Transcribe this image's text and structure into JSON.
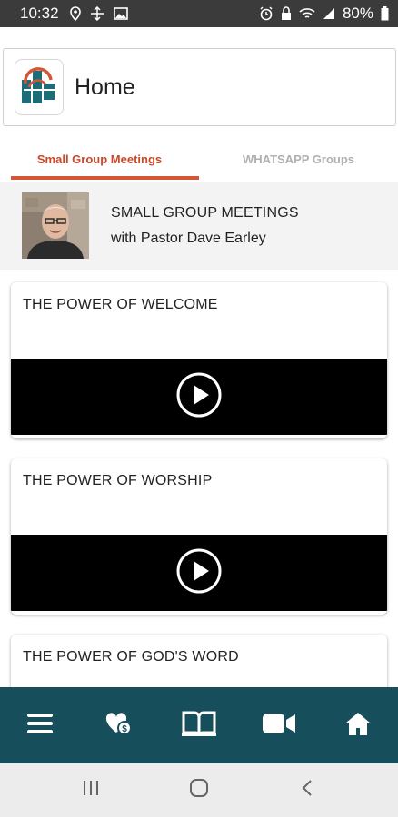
{
  "status_bar": {
    "time": "10:32",
    "battery": "80%"
  },
  "header": {
    "title": "Home",
    "logo_icon": "church-logo-icon"
  },
  "tabs": [
    {
      "label": "Small Group Meetings",
      "active": true
    },
    {
      "label": "WHATSAPP Groups",
      "active": false
    }
  ],
  "banner": {
    "title": "SMALL GROUP MEETINGS",
    "subtitle": "with Pastor Dave Earley"
  },
  "cards": [
    {
      "title": "THE POWER OF WELCOME"
    },
    {
      "title": "THE POWER OF WORSHIP"
    },
    {
      "title": "THE POWER OF GOD'S WORD"
    }
  ],
  "bottom_nav": [
    "menu-icon",
    "heart-hand-icon",
    "bible-icon",
    "video-camera-icon",
    "home-icon"
  ],
  "colors": {
    "accent": "#d1563a",
    "nav_bg": "#174e5b",
    "status_bar": "#3b3b3b"
  }
}
